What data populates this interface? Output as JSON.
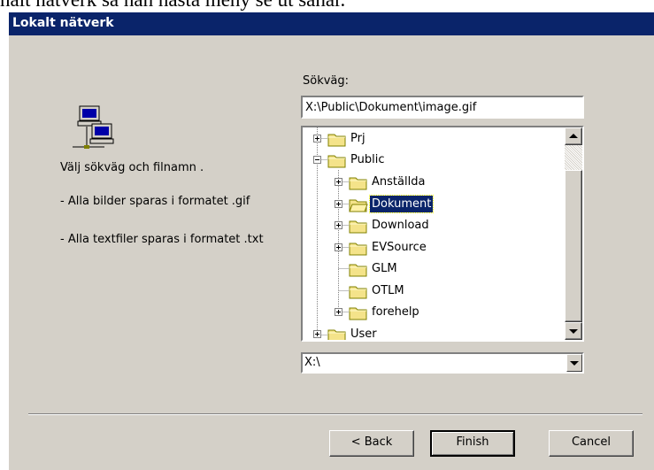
{
  "caption": "nalt nätverk så han nästa meny se ut såhär.",
  "window": {
    "title": "Lokalt nätverk"
  },
  "left_panel": {
    "icon": "network-computers-icon",
    "instruction": "Välj sökväg och filnamn .",
    "note_gif": "- Alla bilder sparas i formatet .gif",
    "note_txt": "- Alla textfiler sparas i formatet .txt"
  },
  "path": {
    "label": "Sökväg:",
    "value": "X:\\Public\\Dokument\\image.gif"
  },
  "tree": {
    "items": [
      {
        "label": "Prj",
        "expander": "plus"
      },
      {
        "label": "Public",
        "expander": "minus"
      },
      {
        "label": "Anställda",
        "expander": "plus"
      },
      {
        "label": "Dokument",
        "expander": "plus",
        "selected": true
      },
      {
        "label": "Download",
        "expander": "plus"
      },
      {
        "label": "EVSource",
        "expander": "plus"
      },
      {
        "label": "GLM",
        "expander": "none"
      },
      {
        "label": "OTLM",
        "expander": "none"
      },
      {
        "label": "forehelp",
        "expander": "plus"
      },
      {
        "label": "User",
        "expander": "plus"
      }
    ]
  },
  "drive": {
    "value": "X:\\"
  },
  "buttons": {
    "back": "< Back",
    "finish": "Finish",
    "cancel": "Cancel"
  },
  "colors": {
    "title_bar": "#0a246a",
    "dialog_bg": "#d4d0c8",
    "selection": "#0a246a",
    "folder": "#f4e38a"
  }
}
